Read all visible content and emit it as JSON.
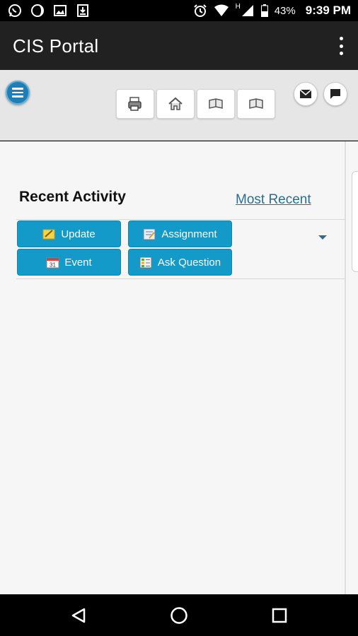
{
  "status_bar": {
    "battery": "43%",
    "time": "9:39 PM",
    "network": "H"
  },
  "app_bar": {
    "title": "CIS Portal"
  },
  "recent_activity": {
    "title": "Recent Activity",
    "filter_label": "Most Recent",
    "actions": [
      {
        "label": "Update",
        "icon": "pencil-note-icon"
      },
      {
        "label": "Assignment",
        "icon": "assignment-icon"
      },
      {
        "label": "Event",
        "icon": "calendar-icon",
        "calendar_day": "31"
      },
      {
        "label": "Ask Question",
        "icon": "question-list-icon"
      }
    ]
  },
  "colors": {
    "action_button": "#139ac9",
    "app_bar": "#212121",
    "link": "#2b6f8e"
  }
}
